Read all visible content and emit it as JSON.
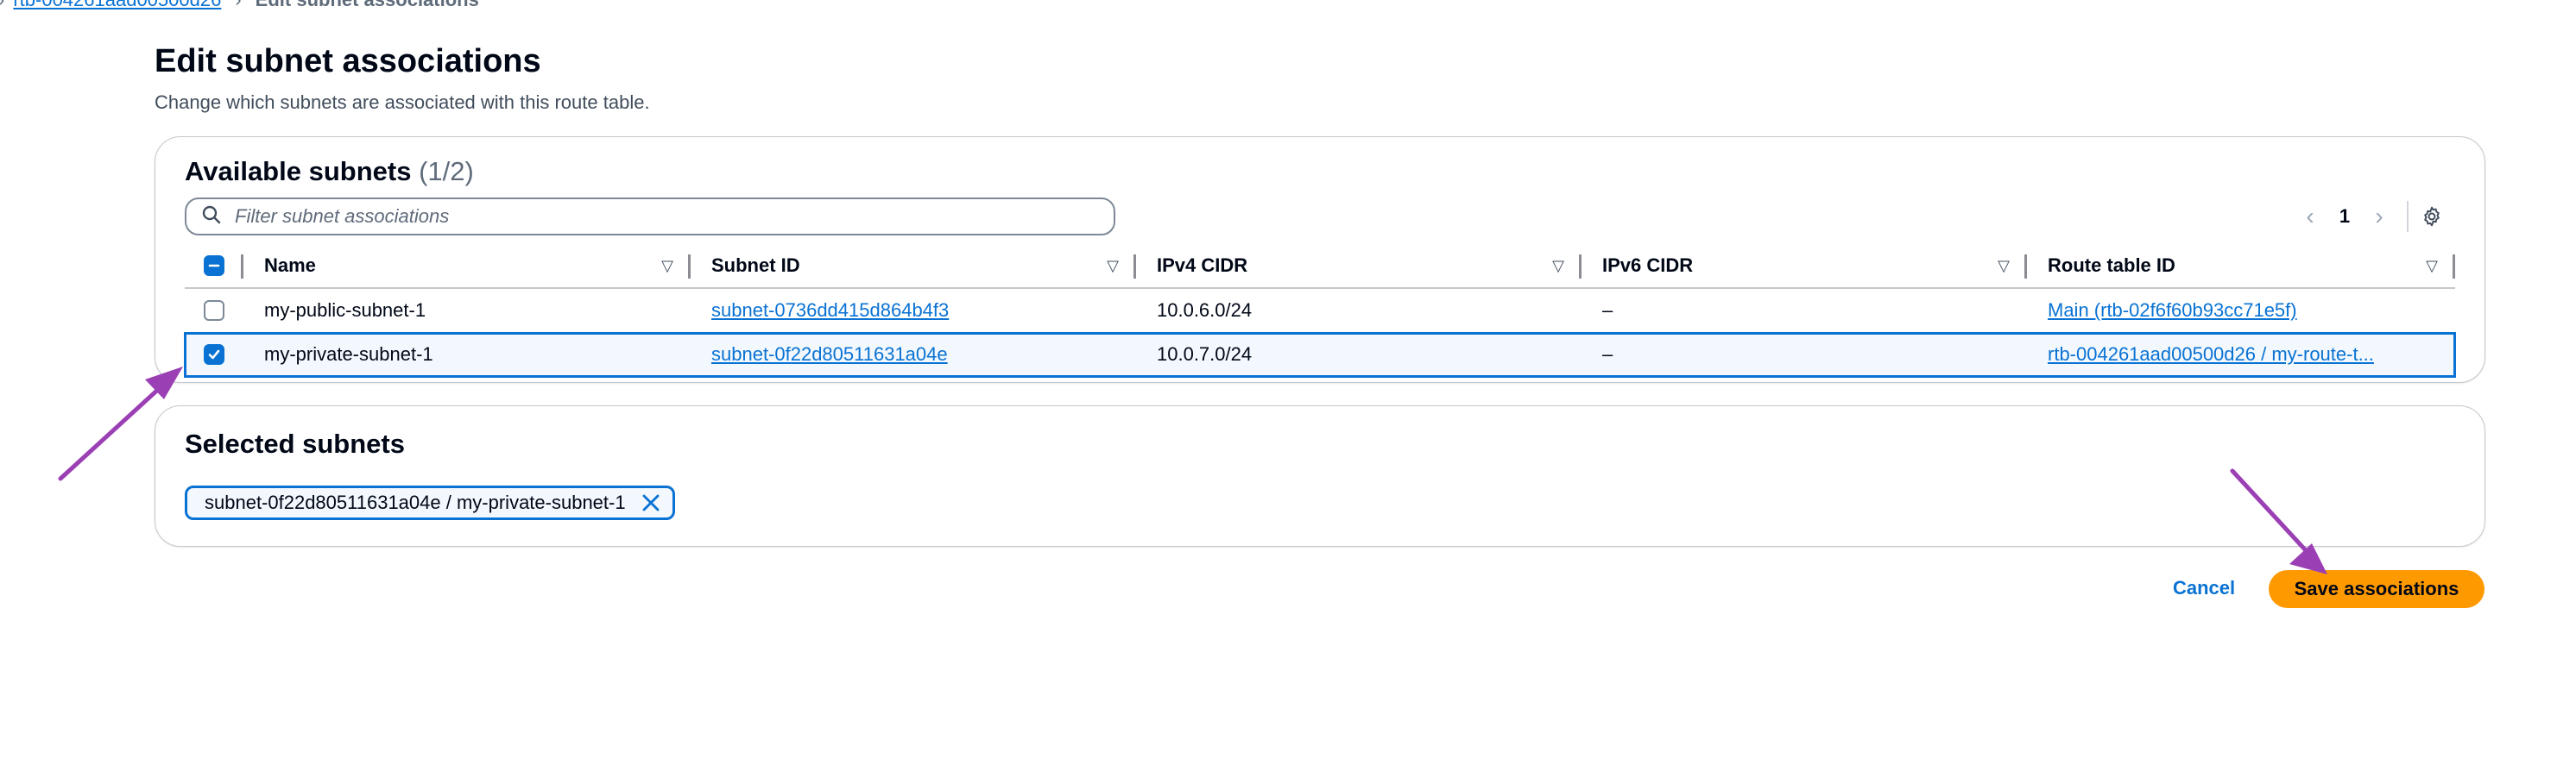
{
  "breadcrumb": {
    "link": "rtb-004261aad00500d26",
    "current": "Edit subnet associations"
  },
  "header": {
    "title": "Edit subnet associations",
    "description": "Change which subnets are associated with this route table."
  },
  "available": {
    "title": "Available subnets",
    "count": "(1/2)",
    "search_placeholder": "Filter subnet associations",
    "page": "1",
    "columns": [
      "Name",
      "Subnet ID",
      "IPv4 CIDR",
      "IPv6 CIDR",
      "Route table ID"
    ],
    "rows": [
      {
        "checked": false,
        "name": "my-public-subnet-1",
        "subnet_id": "subnet-0736dd415d864b4f3",
        "ipv4": "10.0.6.0/24",
        "ipv6": "–",
        "route_table": "Main (rtb-02f6f60b93cc71e5f)"
      },
      {
        "checked": true,
        "name": "my-private-subnet-1",
        "subnet_id": "subnet-0f22d80511631a04e",
        "ipv4": "10.0.7.0/24",
        "ipv6": "–",
        "route_table": "rtb-004261aad00500d26 / my-route-t..."
      }
    ]
  },
  "selected": {
    "title": "Selected subnets",
    "token": "subnet-0f22d80511631a04e / my-private-subnet-1"
  },
  "actions": {
    "cancel": "Cancel",
    "save": "Save associations"
  },
  "colors": {
    "link": "#0972d3",
    "primary_button": "#ff9900",
    "annotation_arrow": "#9b3fb5"
  }
}
